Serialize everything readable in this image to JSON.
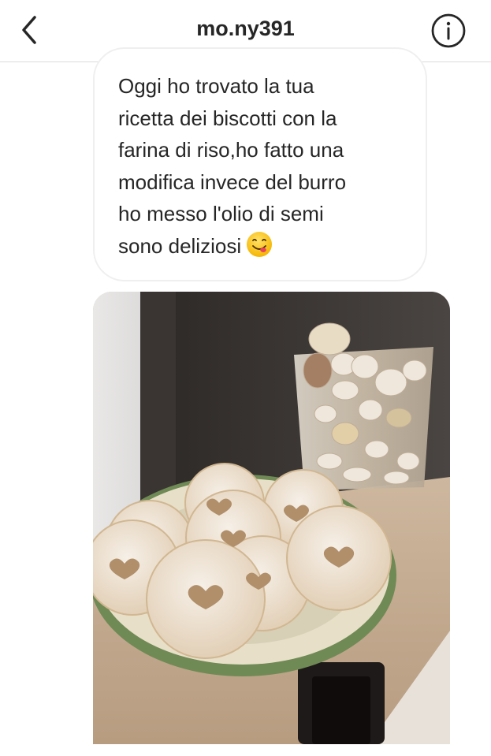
{
  "header": {
    "username": "mo.ny391",
    "back_icon": "chevron-left-icon",
    "info_icon": "info-circle-icon"
  },
  "message": {
    "text": "Oggi ho trovato la tua\nricetta dei biscotti con la\nfarina di riso,ho fatto una\nmodifica invece del burro\nho messo l'olio di semi\nsono deliziosi",
    "emoji": "face-savoring-food-emoji"
  },
  "photo": {
    "subject": "plate-of-heart-cookies-photo"
  },
  "colors": {
    "header_bg": "#ffffff",
    "divider": "#dbdbdb",
    "bubble_border": "#efefef",
    "text": "#262626"
  }
}
